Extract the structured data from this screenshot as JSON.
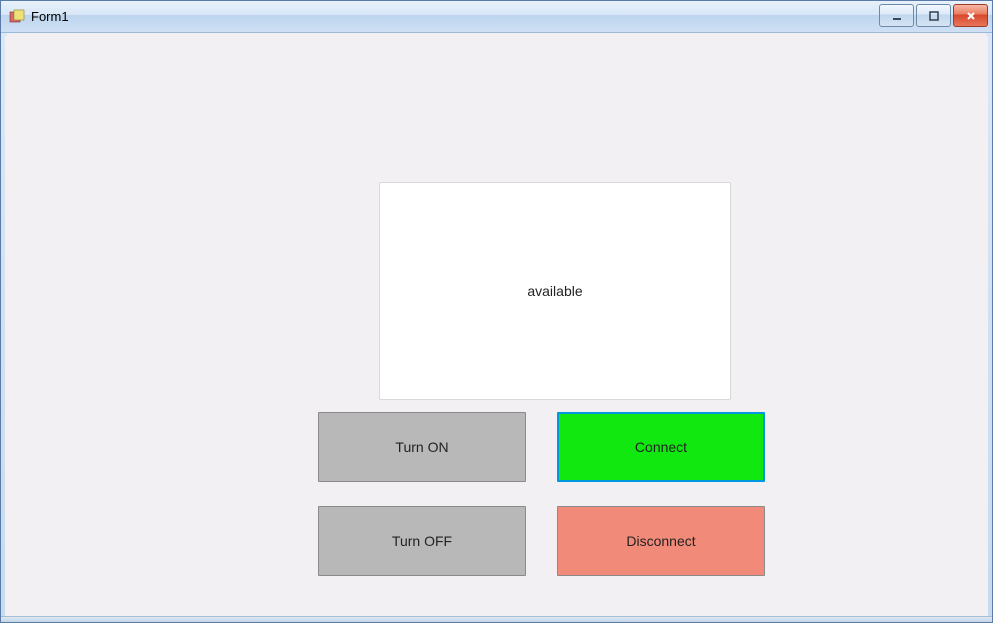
{
  "window": {
    "title": "Form1"
  },
  "status": {
    "text": "available"
  },
  "buttons": {
    "turn_on": "Turn ON",
    "turn_off": "Turn OFF",
    "connect": "Connect",
    "disconnect": "Disconnect"
  }
}
